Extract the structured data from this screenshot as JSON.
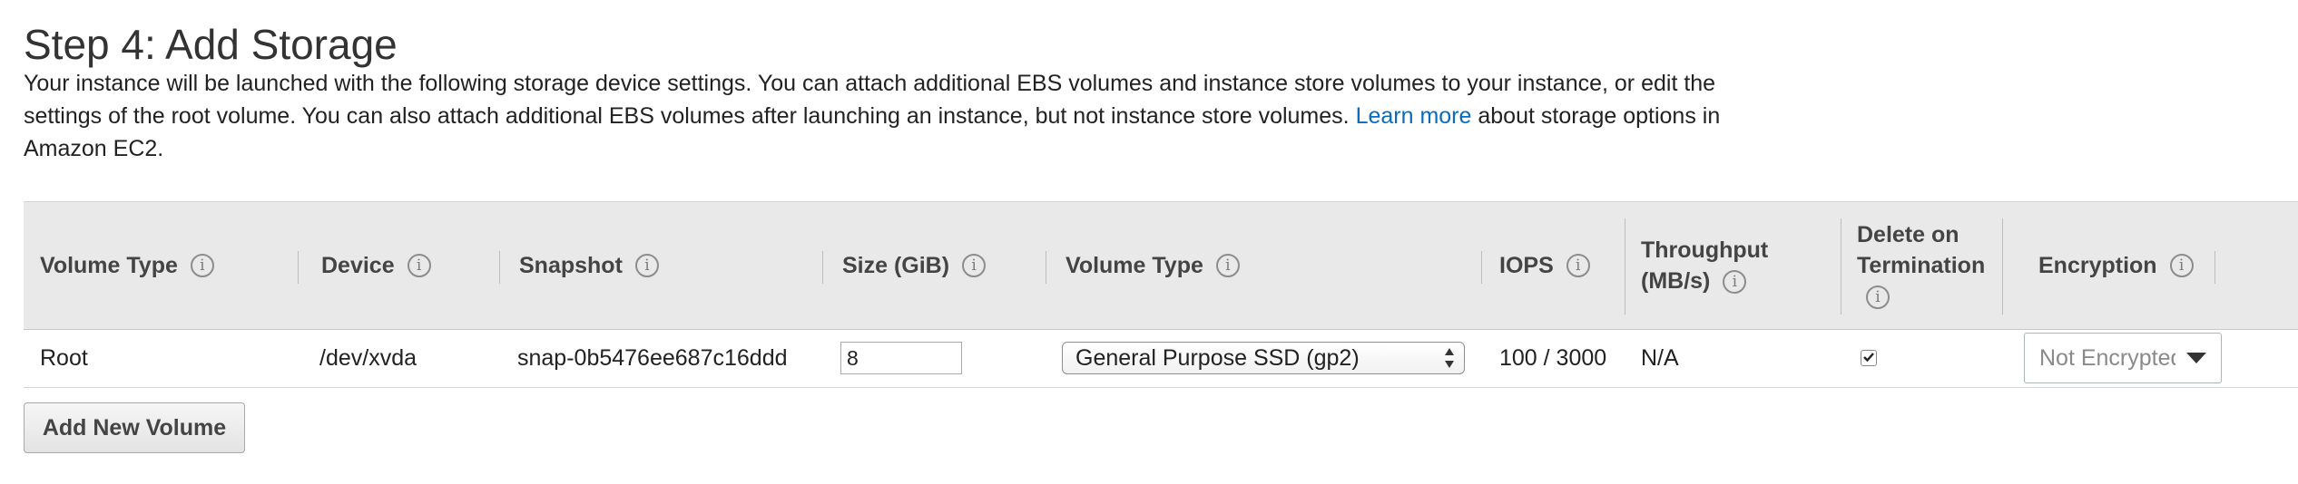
{
  "title": "Step 4: Add Storage",
  "description": {
    "text_before_link": "Your instance will be launched with the following storage device settings. You can attach additional EBS volumes and instance store volumes to your instance, or edit the settings of the root volume. You can also attach additional EBS volumes after launching an instance, but not instance store volumes.",
    "link_text": "Learn more",
    "text_after_link": "about storage options in Amazon EC2."
  },
  "table": {
    "headers": {
      "volume_type": "Volume Type",
      "device": "Device",
      "snapshot": "Snapshot",
      "size": "Size (GiB)",
      "volume_type_2": "Volume Type",
      "iops": "IOPS",
      "throughput_line1": "Throughput",
      "throughput_line2": "(MB/s)",
      "delete_line1": "Delete on",
      "delete_line2": "Termination",
      "encryption": "Encryption"
    },
    "info_glyph": "i",
    "rows": [
      {
        "volume_type": "Root",
        "device": "/dev/xvda",
        "snapshot": "snap-0b5476ee687c16ddd",
        "size": "8",
        "ebs_volume_type": "General Purpose SSD (gp2)",
        "iops": "100 / 3000",
        "throughput": "N/A",
        "delete_on_termination": true,
        "encryption": "Not Encrypted"
      }
    ]
  },
  "buttons": {
    "add_new_volume": "Add New Volume"
  },
  "icons": {
    "info": "info-circle-icon",
    "select_arrows": "updown-arrows-icon",
    "checkbox_check": "checkmark-icon",
    "dropdown_caret": "caret-down-icon"
  },
  "colors": {
    "link": "#0a6bbd",
    "header_bg": "#e9e9e9"
  }
}
